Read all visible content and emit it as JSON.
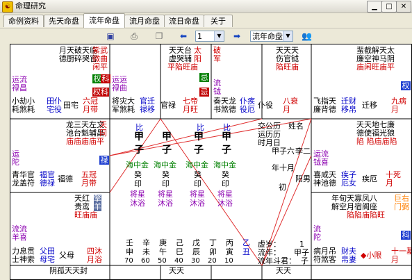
{
  "window": {
    "title": "命理研究",
    "icon": "yin-yang-icon",
    "controls": [
      "minimize",
      "maximize",
      "close"
    ]
  },
  "tabs": [
    "命例资料",
    "先天命盘",
    "流年命盘",
    "流月命盘",
    "流日命盘",
    "关于"
  ],
  "active_tab": "流年命盘",
  "toolbar": {
    "year_value": "1",
    "mode_value": "流年命盘",
    "icons": [
      "save-icon",
      "print-icon",
      "copy-icon",
      "arrow-left-icon",
      "arrow-right-icon",
      "people-icon"
    ]
  },
  "palaces": {
    "top_left": {
      "stars": [
        "月天破天临",
        "德厨碎哭官"
      ],
      "main": [
        "紫武",
        "微曲"
      ],
      "status": "闲平",
      "hua": [
        "权",
        "科"
      ],
      "side": [
        "运流",
        "禄昌"
      ],
      "mid": [
        "权科"
      ],
      "bottom": [
        "小劫小",
        "耗煞耗"
      ],
      "gods": "田仆",
      "gods2": "宅役",
      "house": "田宅",
      "age_hint": "六冠",
      "age_hint2": "月带"
    },
    "top_mid1": {
      "stars": [
        "天天台",
        "虚哭辅"
      ],
      "main": [
        "太",
        "阳"
      ],
      "status": "平陷旺庙",
      "badge": "忌",
      "side": [
        "运运",
        "禄曲"
      ],
      "bottom": [
        "将灾大",
        "军煞耗"
      ],
      "gods": "官迁",
      "gods2": "禄移",
      "house": "官禄",
      "age_hint": "七帝",
      "age_hint2": "月旺"
    },
    "top_mid2": {
      "stars": [
        "天天天",
        "伤官钺"
      ],
      "main": [
        "破",
        "军"
      ],
      "status": "陷",
      "side": [
        "流",
        "钺"
      ],
      "bottom": [
        "奏天龙",
        "书煞德"
      ],
      "gods": "仆疾",
      "gods2": "役厄",
      "house": "仆役",
      "age_hint": "八衰",
      "age_hint2": "月"
    },
    "top_right": {
      "stars": [
        "天天天",
        "伤官钺"
      ],
      "main": [
        "天",
        "府"
      ],
      "status": "陷旺庙",
      "stars_r": [
        "蜚截解天太",
        "廉空神马阴"
      ],
      "status_r": "庙闲旺庙平",
      "badge": "权",
      "bottom": [
        "飞指天",
        "廉背德"
      ],
      "gods": "迁财",
      "gods2": "移帛",
      "house": "迁移",
      "age_hint": "九病",
      "age_hint2": "月"
    },
    "mid_left": {
      "stars": [
        "龙三天左文",
        "池台魁辅昌"
      ],
      "main": [
        "天",
        "同"
      ],
      "status": "庙庙庙庙平",
      "side": [
        "运",
        "陀"
      ],
      "badge": "禄",
      "bottom": [
        "青华官",
        "龙盖符"
      ],
      "gods": "福官",
      "gods2": "德禄",
      "house": "福德",
      "age_hint": "五冠",
      "age_hint2": "月带"
    },
    "mid_right": {
      "stars": [
        "天天地七廉",
        "德使福光狼"
      ],
      "main": [
        "贪",
        "狼"
      ],
      "status": "陷 陷庙庙陷",
      "side": [
        "运流",
        "钺喜"
      ],
      "bottom": [
        "喜咸天",
        "神池德"
      ],
      "gods": "疾子",
      "gods2": "厄女",
      "house": "疾厄",
      "age_hint": "十死",
      "age_hint2": "月"
    },
    "mid2_left": {
      "stars": [
        "天红",
        "贵鸾"
      ],
      "main": [
        "擎",
        "羊"
      ],
      "status": "旺庙庙",
      "side": [
        "流流",
        "羊喜"
      ],
      "bottom": [
        "力息贯",
        "士神索"
      ],
      "gods": "父田",
      "gods2": "母宅",
      "house": "父母",
      "age_hint": "四沐",
      "age_hint2": "月浴"
    },
    "mid2_right": {
      "stars": [
        "年旬天寡凤八",
        "解空月宿阁座"
      ],
      "main": [
        "巨右",
        "门弼"
      ],
      "status": "陷陷庙陷旺",
      "badge": "科",
      "side": [
        "流",
        "陀"
      ],
      "bottom": [
        "病月吊",
        "符煞客"
      ],
      "gods": "财夫",
      "gods2": "帛妻",
      "house": "财帛",
      "age_hint": "十一墓",
      "age_hint2": "月"
    },
    "bottom": {
      "left": [
        "阴孤天天封",
        "煞辰厨喜诰"
      ],
      "mid": [
        "天天",
        "福巫"
      ],
      "right": [
        "天天",
        "寿姚"
      ]
    }
  },
  "center": {
    "pillars": [
      {
        "label": "比",
        "top": "甲",
        "bottom": "子",
        "nayin": "海中金",
        "cang": "癸",
        "shen": "印",
        "star": "将星",
        "state": "沐浴"
      },
      {
        "label": "",
        "top": "甲",
        "bottom": "子",
        "nayin": "海中金",
        "cang": "癸",
        "shen": "印",
        "star": "将星",
        "state": "沐浴"
      },
      {
        "label": "比",
        "top": "甲",
        "bottom": "子",
        "nayin": "海中金",
        "cang": "癸",
        "shen": "印",
        "star": "将星",
        "state": "沐浴"
      },
      {
        "label": "比",
        "top": "甲",
        "bottom": "子",
        "nayin": "海中金",
        "cang": "癸",
        "shen": "印",
        "star": "将星",
        "state": "沐浴"
      }
    ],
    "right_info": [
      "姓名",
      "交公历",
      "运历历",
      "时月日",
      "甲子六",
      "李二",
      "年十月",
      "初",
      "阳男"
    ],
    "dayun_stems": [
      "壬",
      "辛",
      "庚",
      "己",
      "戊",
      "丁",
      "丙",
      "乙"
    ],
    "dayun_branches": [
      "申",
      "未",
      "午",
      "巳",
      "辰",
      "卯",
      "寅",
      "丑"
    ],
    "dayun_ages": [
      "70",
      "60",
      "50",
      "40",
      "30",
      "20",
      "10",
      ""
    ],
    "nian": {
      "xusui_label": "虚岁：",
      "xusui": "1",
      "liunian_label": "流年：",
      "liunian": "甲子",
      "doujun_label": "流年斗君：",
      "doujun": "子",
      "xiaoxian": "◆小限",
      "shen": "身"
    }
  }
}
